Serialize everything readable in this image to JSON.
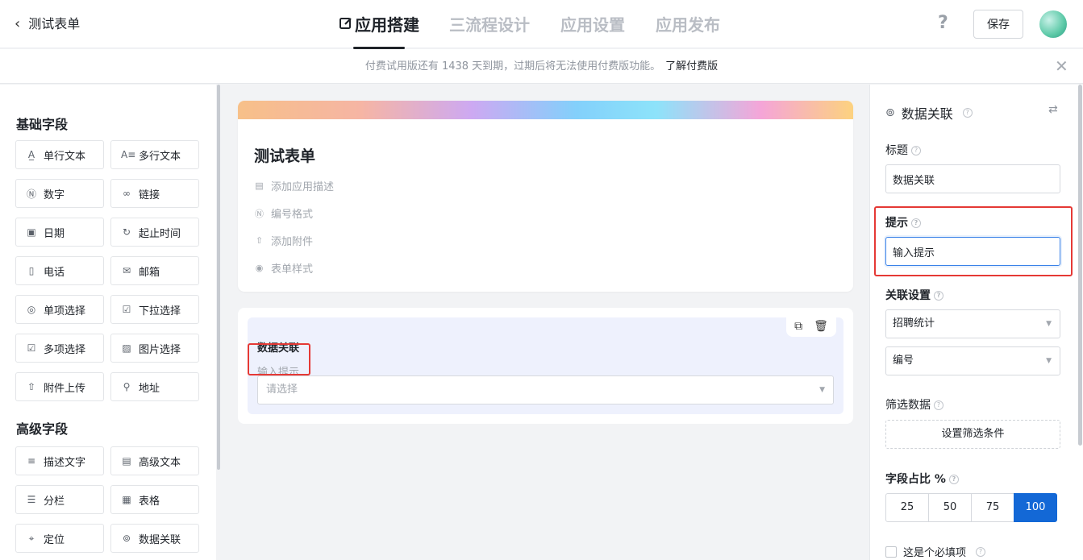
{
  "header": {
    "back_title": "测试表单",
    "tabs": [
      "应用搭建",
      "三流程设计",
      "应用设置",
      "应用发布"
    ],
    "help": "?",
    "save": "保存"
  },
  "notice": {
    "text": "付费试用版还有 1438 天到期，过期后将无法使用付费版功能。",
    "link": "了解付费版",
    "close": "✕"
  },
  "palette": {
    "basic_title": "基础字段",
    "basic": [
      {
        "label": "单行文本",
        "icon": "single-line-text-icon"
      },
      {
        "label": "多行文本",
        "icon": "multi-line-text-icon"
      },
      {
        "label": "数字",
        "icon": "number-icon"
      },
      {
        "label": "链接",
        "icon": "link-icon"
      },
      {
        "label": "日期",
        "icon": "calendar-icon"
      },
      {
        "label": "起止时间",
        "icon": "time-range-icon"
      },
      {
        "label": "电话",
        "icon": "phone-icon"
      },
      {
        "label": "邮箱",
        "icon": "mail-icon"
      },
      {
        "label": "单项选择",
        "icon": "radio-icon"
      },
      {
        "label": "下拉选择",
        "icon": "dropdown-icon"
      },
      {
        "label": "多项选择",
        "icon": "checkbox-icon"
      },
      {
        "label": "图片选择",
        "icon": "image-icon"
      },
      {
        "label": "附件上传",
        "icon": "upload-icon"
      },
      {
        "label": "地址",
        "icon": "address-icon"
      }
    ],
    "advanced_title": "高级字段",
    "advanced": [
      {
        "label": "描述文字",
        "icon": "description-icon"
      },
      {
        "label": "高级文本",
        "icon": "rich-text-icon"
      },
      {
        "label": "分栏",
        "icon": "columns-icon"
      },
      {
        "label": "表格",
        "icon": "table-icon"
      },
      {
        "label": "定位",
        "icon": "location-icon"
      },
      {
        "label": "数据关联",
        "icon": "data-link-icon"
      }
    ]
  },
  "form": {
    "title": "测试表单",
    "meta": [
      "添加应用描述",
      "编号格式",
      "添加附件",
      "表单样式"
    ],
    "item_label": "数据关联",
    "item_hint": "输入提示",
    "item_placeholder": "请选择"
  },
  "panel": {
    "title": "数据关联",
    "label_title": "标题",
    "title_value": "数据关联",
    "label_hint": "提示",
    "hint_value": "输入提示",
    "label_link": "关联设置",
    "link_select1": "招聘统计",
    "link_select2": "编号",
    "label_filter": "筛选数据",
    "filter_button": "设置筛选条件",
    "label_ratio": "字段占比 %",
    "ratio_options": [
      "25",
      "50",
      "75",
      "100"
    ],
    "ratio_selected": "100",
    "required_label": "这是个必填项"
  },
  "colors": {
    "accent": "#1368d6",
    "highlight": "#e53935",
    "item_bg": "#eef1fd"
  }
}
